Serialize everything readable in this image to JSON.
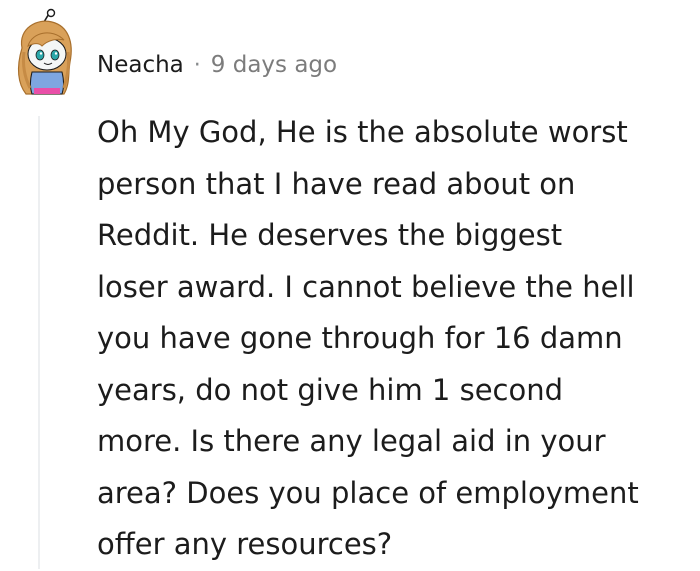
{
  "comment": {
    "author": "Neacha",
    "separator": "·",
    "timestamp": "9 days ago",
    "body_lines": [
      "Oh My God, He is the absolute worst",
      "person that I have read about on",
      "Reddit. He deserves the biggest",
      "loser award. I cannot believe the hell",
      "you have gone through for 16 damn",
      "years, do not give him 1 second",
      "more. Is there any legal aid in your",
      "area? Does you place of employment",
      "offer any resources?"
    ]
  },
  "avatar": {
    "icon": "snoo-avatar-icon",
    "hair_color": "#d9a15a",
    "face_color": "#f4f7f7",
    "shirt_color": "#7ea6e0",
    "accent_color": "#e94fa8",
    "eye_color": "#2aa7a9"
  },
  "colors": {
    "text": "#1c1c1c",
    "meta": "#7c7c7c",
    "thread_line": "#edeff1"
  }
}
